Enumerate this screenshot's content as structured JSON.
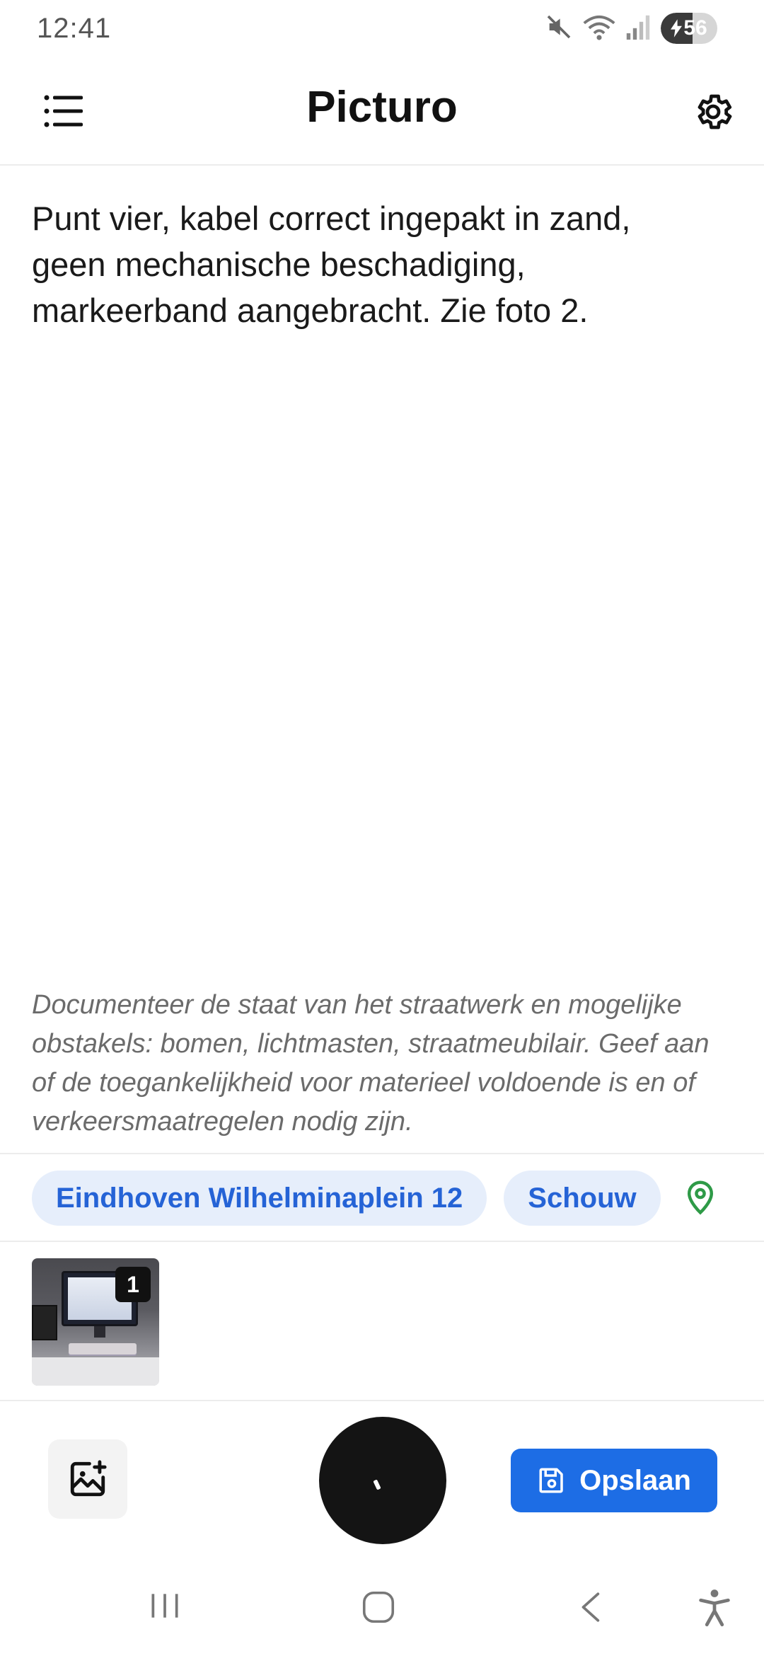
{
  "status_bar": {
    "time": "12:41",
    "battery_level": "56",
    "icons": [
      "mute-icon",
      "wifi-icon",
      "signal-icon",
      "battery-charging-icon"
    ]
  },
  "app_bar": {
    "title": "Picturo",
    "menu_icon": "list-menu-icon",
    "settings_icon": "gear-icon"
  },
  "note": {
    "text": "Punt vier, kabel correct ingepakt in zand, geen mechanische beschadiging, markeerband aangebracht. Zie foto 2."
  },
  "instruction": {
    "text": "Documenteer de staat van het straatwerk en mogelijke obstakels: bomen, lichtmasten, straatmeubilair. Geef aan of de toegankelijkheid voor materieel voldoende is en of verkeersmaatregelen nodig zijn."
  },
  "chips": {
    "location": "Eindhoven Wilhelminaplein 12",
    "type": "Schouw",
    "pin_icon": "location-pin-icon"
  },
  "photos": {
    "items": [
      {
        "badge": "1"
      }
    ]
  },
  "actions": {
    "add_image_icon": "add-image-icon",
    "record_icon": "record-icon",
    "save_label": "Opslaan",
    "save_icon": "floppy-disk-icon"
  },
  "colors": {
    "accent": "#1d6de5",
    "chip_bg": "#e6eefb",
    "chip_text": "#2563d6",
    "pin": "#2e9a47",
    "record": "#141414"
  },
  "nav_bar": {
    "icons": [
      "recent-apps-icon",
      "home-icon",
      "back-icon",
      "accessibility-icon"
    ]
  }
}
